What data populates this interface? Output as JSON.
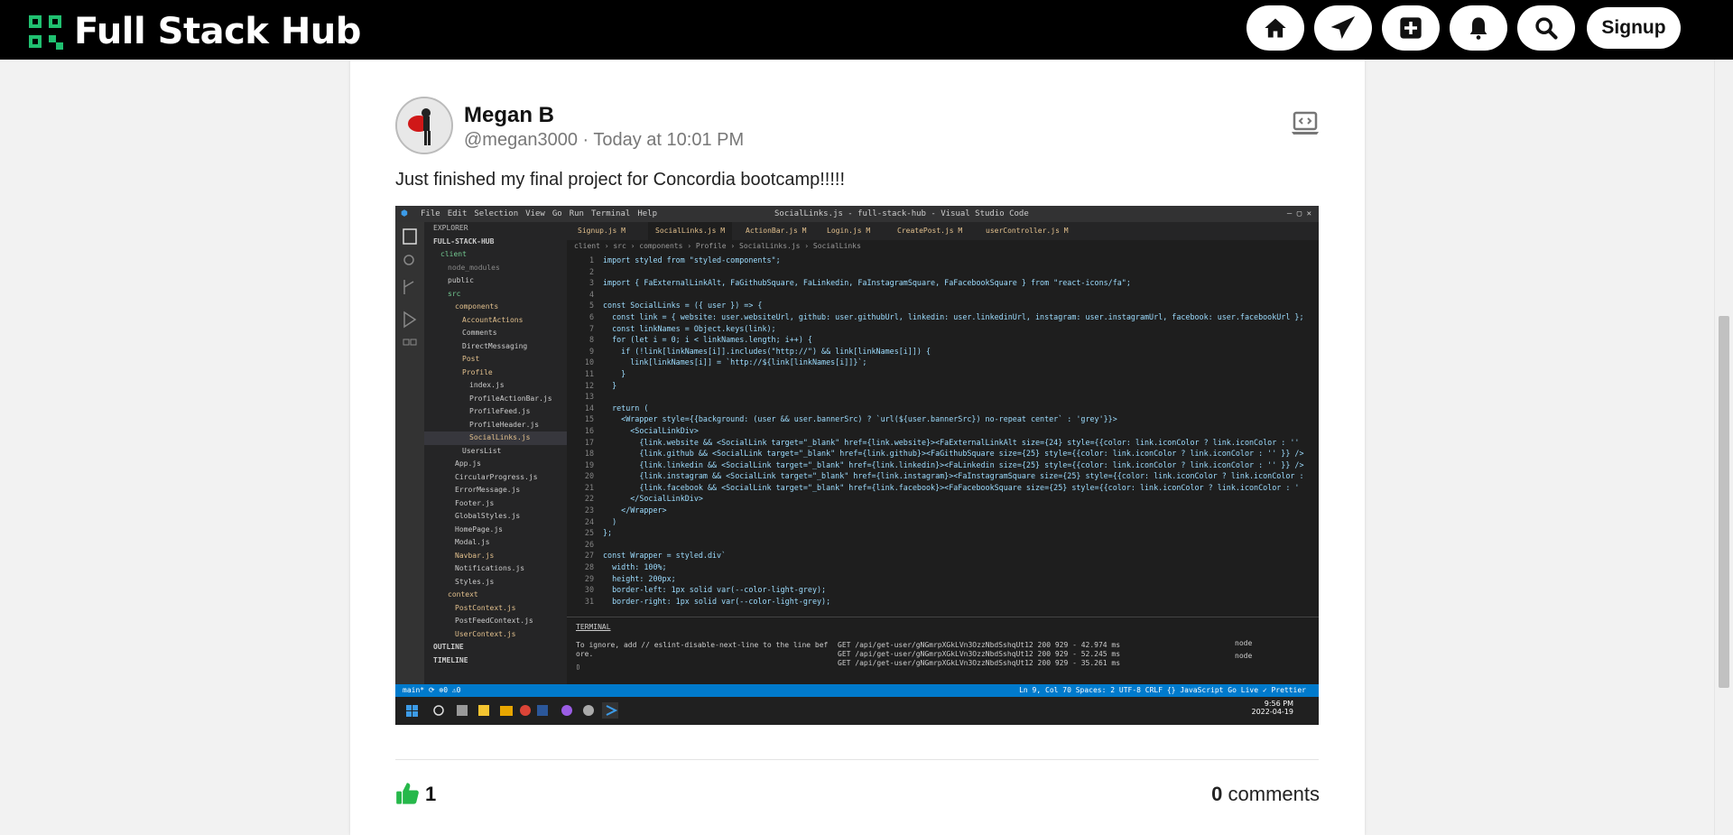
{
  "header": {
    "brand_title": "Full Stack Hub",
    "nav_icons": [
      "home-icon",
      "paper-plane-icon",
      "plus-square-icon",
      "bell-icon",
      "search-icon"
    ],
    "signup_label": "Signup"
  },
  "post": {
    "author_name": "Megan B",
    "author_meta": "@megan3000 · Today at 10:01 PM",
    "text": "Just finished my final project for Concordia bootcamp!!!!!",
    "code_link_icon": "laptop-code-icon",
    "like_count": "1",
    "comment_count": "0",
    "comment_label": "comments"
  },
  "screenshot": {
    "menu": [
      "File",
      "Edit",
      "Selection",
      "View",
      "Go",
      "Run",
      "Terminal",
      "Help"
    ],
    "window_title": "SocialLinks.js - full-stack-hub - Visual Studio Code",
    "explorer_title": "EXPLORER",
    "explorer_items": [
      "FULL-STACK-HUB",
      "client",
      "node_modules",
      "public",
      "src",
      "components",
      "AccountActions",
      "Comments",
      "DirectMessaging",
      "Post",
      "Profile",
      "index.js",
      "ProfileActionBar.js",
      "ProfileFeed.js",
      "ProfileHeader.js",
      "SocialLinks.js",
      "UsersList",
      "App.js",
      "CircularProgress.js",
      "ErrorMessage.js",
      "Footer.js",
      "GlobalStyles.js",
      "HomePage.js",
      "Modal.js",
      "Navbar.js",
      "Notifications.js",
      "Styles.js",
      "context",
      "PostContext.js",
      "PostFeedContext.js",
      "UserContext.js",
      "OUTLINE",
      "TIMELINE"
    ],
    "tabs": [
      "Signup.js M",
      "SocialLinks.js M",
      "ActionBar.js M",
      "Login.js M",
      "CreatePost.js M",
      "userController.js M"
    ],
    "breadcrumb": "client › src › components › Profile › SocialLinks.js › SocialLinks",
    "code_lines": [
      "import styled from \"styled-components\";",
      "",
      "import { FaExternalLinkAlt, FaGithubSquare, FaLinkedin, FaInstagramSquare, FaFacebookSquare } from \"react-icons/fa\";",
      "",
      "const SocialLinks = ({ user }) => {",
      "  const link = { website: user.websiteUrl, github: user.githubUrl, linkedin: user.linkedinUrl, instagram: user.instagramUrl, facebook: user.facebookUrl };",
      "  const linkNames = Object.keys(link);",
      "  for (let i = 0; i < linkNames.length; i++) {",
      "    if (!link[linkNames[i]].includes(\"http://\") && link[linkNames[i]]) {",
      "      link[linkNames[i]] = `http://${link[linkNames[i]]}`;",
      "    }",
      "  }",
      "",
      "  return (",
      "    <Wrapper style={{background: (user && user.bannerSrc) ? `url(${user.bannerSrc}) no-repeat center` : 'grey'}}>",
      "      <SocialLinkDiv>",
      "        {link.website && <SocialLink target=\"_blank\" href={link.website}><FaExternalLinkAlt size={24} style={{color: link.iconColor ? link.iconColor : ''",
      "        {link.github && <SocialLink target=\"_blank\" href={link.github}><FaGithubSquare size={25} style={{color: link.iconColor ? link.iconColor : '' }} />",
      "        {link.linkedin && <SocialLink target=\"_blank\" href={link.linkedin}><FaLinkedin size={25} style={{color: link.iconColor ? link.iconColor : '' }} />",
      "        {link.instagram && <SocialLink target=\"_blank\" href={link.instagram}><FaInstagramSquare size={25} style={{color: link.iconColor ? link.iconColor :",
      "        {link.facebook && <SocialLink target=\"_blank\" href={link.facebook}><FaFacebookSquare size={25} style={{color: link.iconColor ? link.iconColor : '",
      "      </SocialLinkDiv>",
      "    </Wrapper>",
      "  )",
      "};",
      "",
      "const Wrapper = styled.div`",
      "  width: 100%;",
      "  height: 200px;",
      "  border-left: 1px solid var(--color-light-grey);",
      "  border-right: 1px solid var(--color-light-grey);"
    ],
    "terminal_label": "TERMINAL",
    "terminal_left": [
      "To ignore, add // eslint-disable-next-line to the line bef",
      "ore.",
      "▯"
    ],
    "terminal_right": [
      "GET /api/get-user/gNGmrpXGkLVn3OzzNbdSshqUt12 200 929 - 42.974 ms",
      "GET /api/get-user/gNGmrpXGkLVn3OzzNbdSshqUt12 200 929 - 52.245 ms",
      "GET /api/get-user/gNGmrpXGkLVn3OzzNbdSshqUt12 200 929 - 35.261 ms"
    ],
    "terminal_sessions": [
      "node",
      "node"
    ],
    "status_left": "main*  ⟳  ⊗0 ⚠0",
    "status_right": "Ln 9, Col 70   Spaces: 2   UTF-8   CRLF   {} JavaScript   Go Live   ✓ Prettier",
    "clock_time": "9:56 PM",
    "clock_date": "2022-04-19"
  }
}
